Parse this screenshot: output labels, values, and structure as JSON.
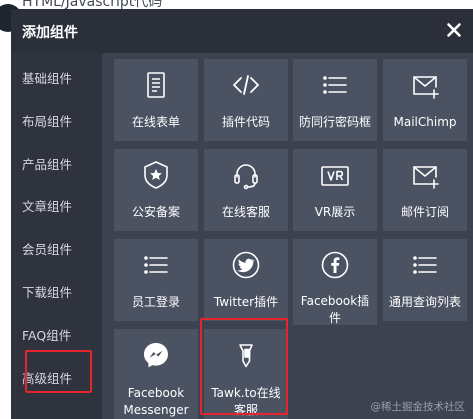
{
  "background": {
    "partial_text": "HTML/Javascript代码"
  },
  "modal": {
    "title": "添加组件",
    "close_symbol": "×"
  },
  "sidebar": {
    "items": [
      {
        "label": "基础组件"
      },
      {
        "label": "布局组件"
      },
      {
        "label": "产品组件"
      },
      {
        "label": "文章组件"
      },
      {
        "label": "会员组件"
      },
      {
        "label": "下载组件"
      },
      {
        "label": "FAQ组件"
      },
      {
        "label": "高级组件",
        "highlighted": true
      }
    ]
  },
  "widgets": [
    {
      "label": "在线表单",
      "icon": "form-icon"
    },
    {
      "label": "插件代码",
      "icon": "code-icon"
    },
    {
      "label": "防同行密码框",
      "icon": "list-icon"
    },
    {
      "label": "MailChimp",
      "icon": "mail-plus-icon"
    },
    {
      "label": "公安备案",
      "icon": "police-badge-icon"
    },
    {
      "label": "在线客服",
      "icon": "headset-icon"
    },
    {
      "label": "VR展示",
      "icon": "vr-icon"
    },
    {
      "label": "邮件订阅",
      "icon": "mail-plus-icon"
    },
    {
      "label": "员工登录",
      "icon": "list-icon"
    },
    {
      "label": "Twitter插件",
      "icon": "twitter-icon"
    },
    {
      "label": "Facebook插件",
      "icon": "facebook-icon"
    },
    {
      "label": "通用查询列表",
      "icon": "list-icon"
    },
    {
      "label": "Facebook Messenger",
      "icon": "messenger-icon"
    },
    {
      "label": "Tawk.to在线客服",
      "icon": "tawk-icon",
      "highlighted": true
    }
  ],
  "watermark": "@稀土掘金技术社区",
  "colors": {
    "header_bg": "#2a2f39",
    "sidebar_bg": "#2e333d",
    "panel_bg": "#3c4250",
    "tile_bg": "#4b5262",
    "highlight": "#e4262c"
  }
}
